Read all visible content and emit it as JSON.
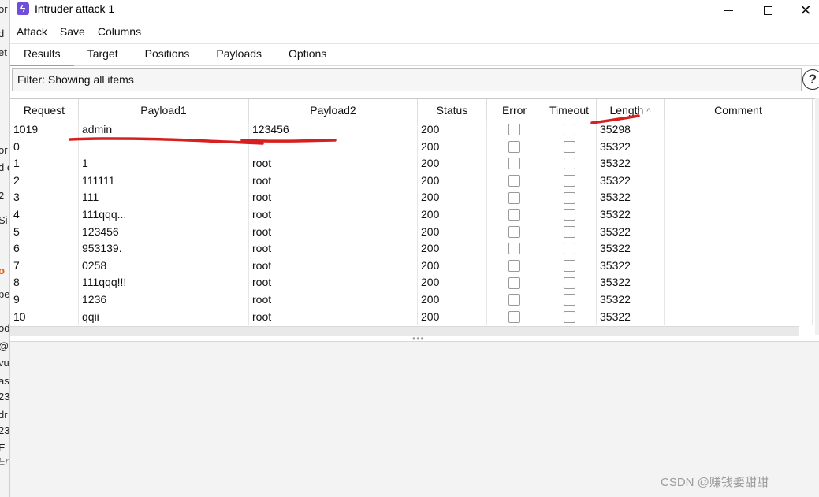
{
  "window": {
    "title": "Intruder attack 1",
    "app_icon": "lightning-icon",
    "controls": {
      "minimize": "minimize-icon",
      "maximize": "maximize-icon",
      "close": "✕"
    }
  },
  "menu": [
    "Attack",
    "Save",
    "Columns"
  ],
  "tabs": [
    {
      "label": "Results",
      "active": true
    },
    {
      "label": "Target",
      "active": false
    },
    {
      "label": "Positions",
      "active": false
    },
    {
      "label": "Payloads",
      "active": false
    },
    {
      "label": "Options",
      "active": false
    }
  ],
  "filter": {
    "text": "Filter: Showing all items",
    "help_glyph": "?"
  },
  "table": {
    "columns": [
      "Request",
      "Payload1",
      "Payload2",
      "Status",
      "Error",
      "Timeout",
      "Length",
      "Comment"
    ],
    "sort_column": "Length",
    "sort_glyph": "^",
    "rows": [
      {
        "request": "1019",
        "payload1": "admin",
        "payload2": "123456",
        "status": "200",
        "error": false,
        "timeout": false,
        "length": "35298",
        "comment": ""
      },
      {
        "request": "0",
        "payload1": "",
        "payload2": "",
        "status": "200",
        "error": false,
        "timeout": false,
        "length": "35322",
        "comment": ""
      },
      {
        "request": "1",
        "payload1": "1",
        "payload2": "root",
        "status": "200",
        "error": false,
        "timeout": false,
        "length": "35322",
        "comment": ""
      },
      {
        "request": "2",
        "payload1": "111111",
        "payload2": "root",
        "status": "200",
        "error": false,
        "timeout": false,
        "length": "35322",
        "comment": ""
      },
      {
        "request": "3",
        "payload1": "111",
        "payload2": "root",
        "status": "200",
        "error": false,
        "timeout": false,
        "length": "35322",
        "comment": ""
      },
      {
        "request": "4",
        "payload1": "111qqq...",
        "payload2": "root",
        "status": "200",
        "error": false,
        "timeout": false,
        "length": "35322",
        "comment": ""
      },
      {
        "request": "5",
        "payload1": "123456",
        "payload2": "root",
        "status": "200",
        "error": false,
        "timeout": false,
        "length": "35322",
        "comment": ""
      },
      {
        "request": "6",
        "payload1": "953139.",
        "payload2": "root",
        "status": "200",
        "error": false,
        "timeout": false,
        "length": "35322",
        "comment": ""
      },
      {
        "request": "7",
        "payload1": "0258",
        "payload2": "root",
        "status": "200",
        "error": false,
        "timeout": false,
        "length": "35322",
        "comment": ""
      },
      {
        "request": "8",
        "payload1": "111qqq!!!",
        "payload2": "root",
        "status": "200",
        "error": false,
        "timeout": false,
        "length": "35322",
        "comment": ""
      },
      {
        "request": "9",
        "payload1": "1236",
        "payload2": "root",
        "status": "200",
        "error": false,
        "timeout": false,
        "length": "35322",
        "comment": ""
      },
      {
        "request": "10",
        "payload1": "qqii",
        "payload2": "root",
        "status": "200",
        "error": false,
        "timeout": false,
        "length": "35322",
        "comment": ""
      }
    ]
  },
  "splitter_glyph": "•••",
  "annotation_color": "#d61f1f",
  "watermark": "CSDN @赚钱娶甜甜",
  "background_window_fragments": [
    "or",
    "d",
    "et",
    "or",
    "d e",
    "2",
    "Si",
    "o",
    "pe",
    "od",
    "@",
    "vul",
    "as",
    "23",
    "dr",
    "23",
    "E",
    "En"
  ]
}
